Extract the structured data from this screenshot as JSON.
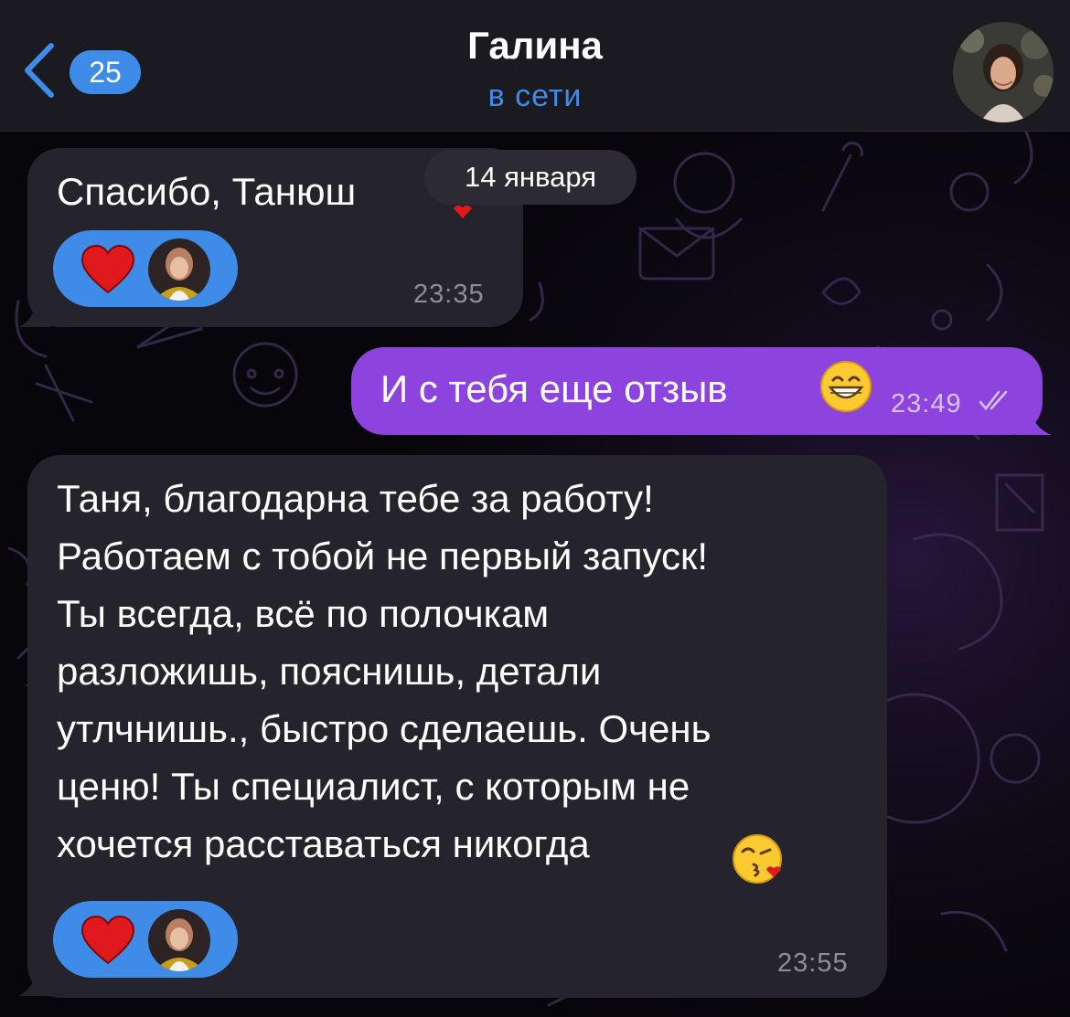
{
  "header": {
    "back_count": "25",
    "contact_name": "Галина",
    "status": "в сети"
  },
  "date_separator": "14 января",
  "messages": [
    {
      "direction": "incoming",
      "text": "Спасибо, Танюш",
      "trailing_emoji": "heart",
      "reaction": {
        "emoji": "heart",
        "by": "avatar"
      },
      "time": "23:35"
    },
    {
      "direction": "outgoing",
      "text": "И с тебя еще отзыв",
      "trailing_emoji": "grinning-face-with-smiling-eyes",
      "time": "23:49",
      "status": "read"
    },
    {
      "direction": "incoming",
      "lines": [
        "Таня, благодарна тебе за работу!",
        "Работаем с тобой не первый запуск!",
        "Ты всегда, всё по полочкам",
        "разложишь, пояснишь, детали",
        "утлчнишь., быстро сделаешь. Очень",
        "ценю! Ты специалист, с которым не",
        "хочется расставаться никогда"
      ],
      "trailing_emoji": "face-blowing-a-kiss",
      "reaction": {
        "emoji": "heart",
        "by": "avatar"
      },
      "time": "23:55"
    }
  ],
  "colors": {
    "accent_blue": "#3e8ce8",
    "outgoing_bubble": "#8d44df",
    "incoming_bubble": "#25232b",
    "header_bg": "#1b1a20"
  }
}
